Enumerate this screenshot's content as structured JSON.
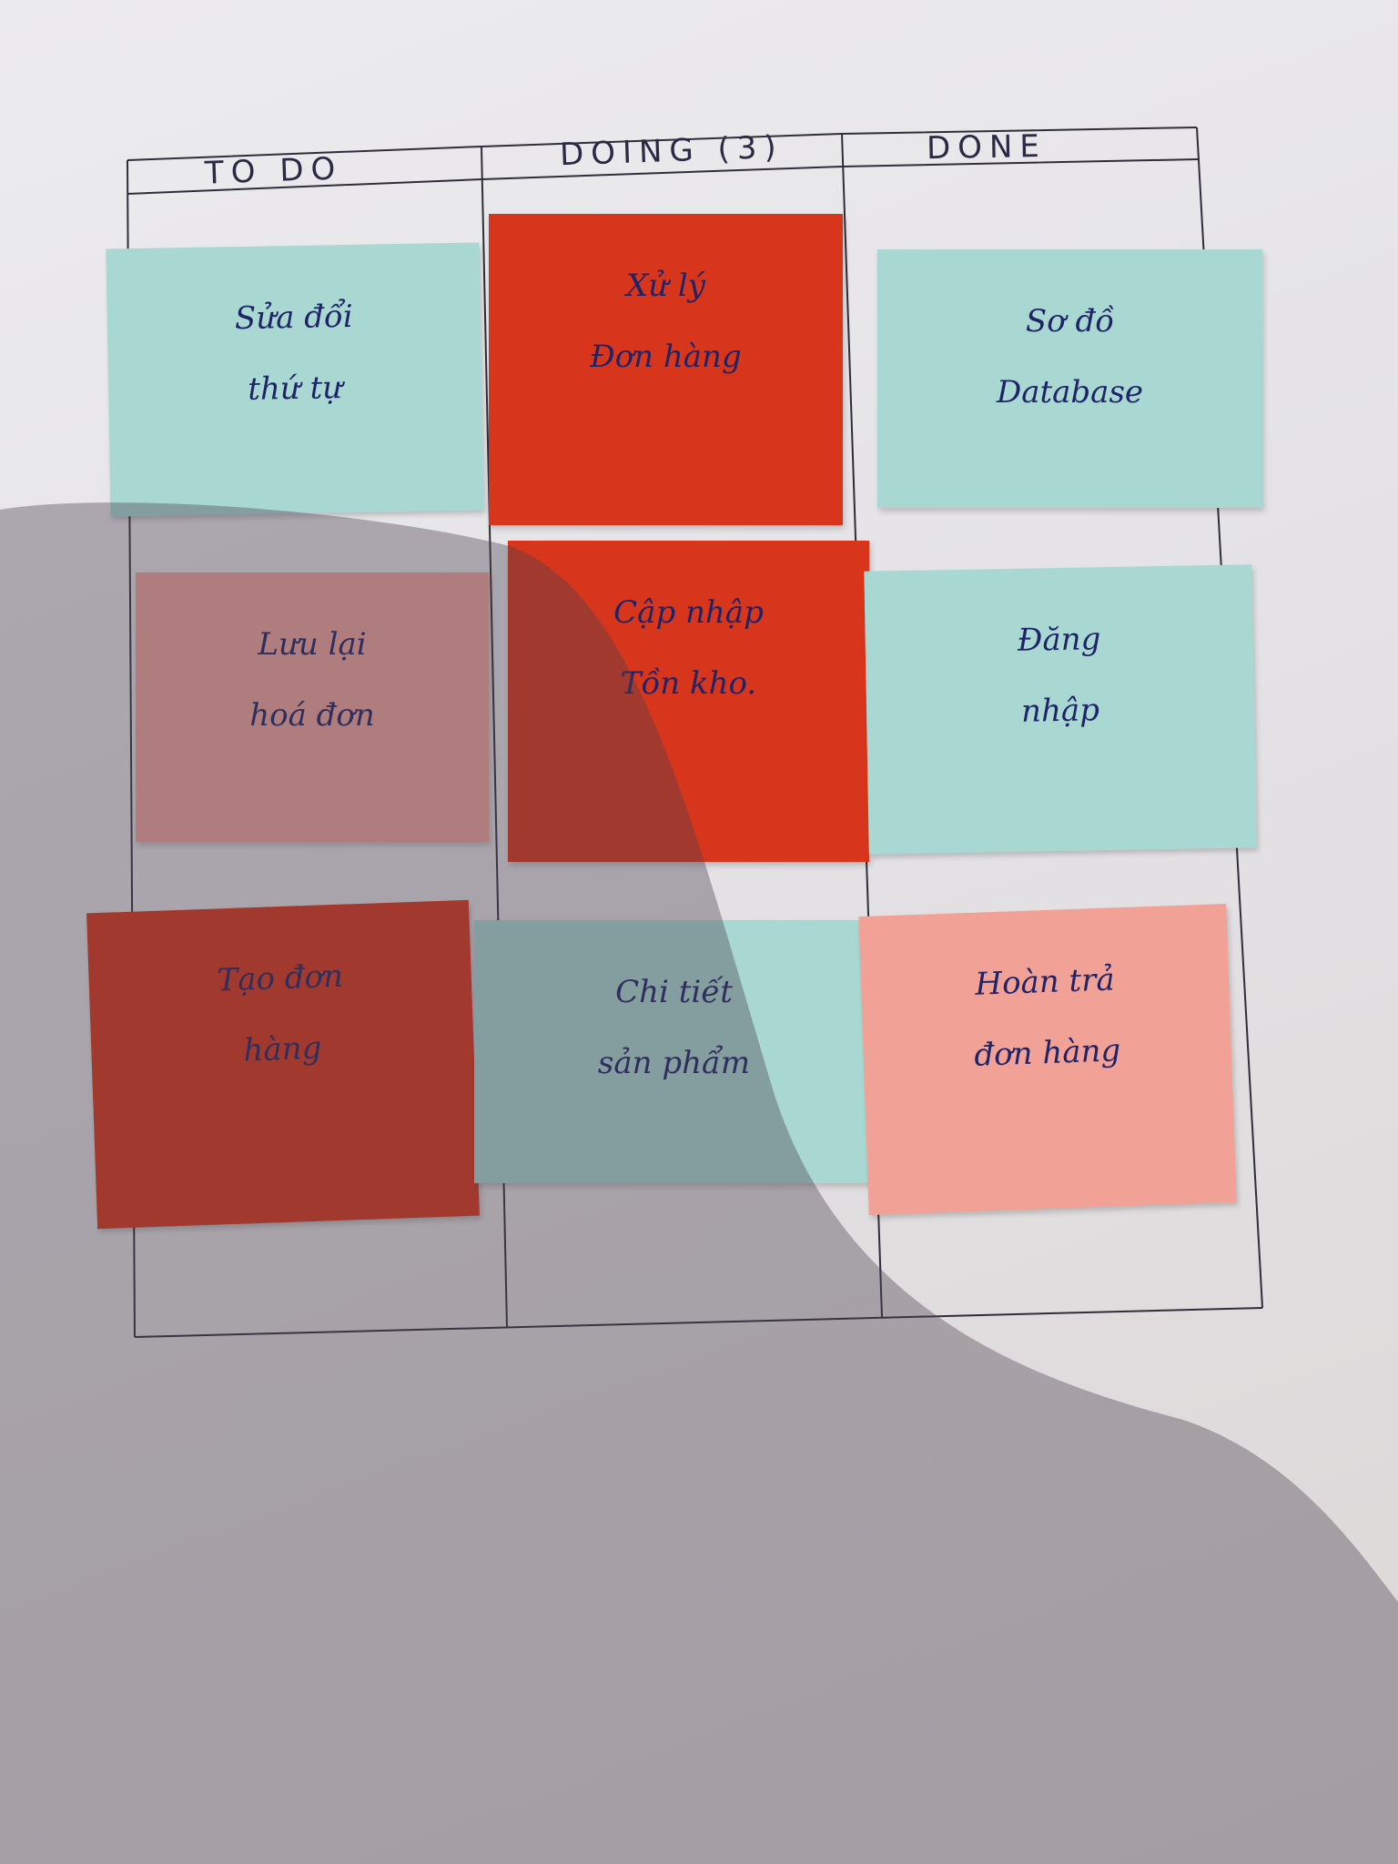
{
  "board": {
    "columns": [
      "TO DO",
      "DOING (3)",
      "DONE"
    ],
    "notes": [
      {
        "column": "TO DO",
        "color": "#a9d8d2",
        "line1": "Sửa đổi",
        "line2": "thứ tự"
      },
      {
        "column": "DOING (3)",
        "color": "#d8361c",
        "line1": "Xử lý",
        "line2": "Đơn hàng"
      },
      {
        "column": "DONE",
        "color": "#a9d8d2",
        "line1": "Sơ đồ",
        "line2": "Database"
      },
      {
        "column": "TO DO",
        "color": "#eea39d",
        "line1": "Lưu lại",
        "line2": "hoá đơn"
      },
      {
        "column": "DOING (3)",
        "color": "#d8361c",
        "line1": "Cập nhập",
        "line2": "Tồn kho."
      },
      {
        "column": "DONE",
        "color": "#a9d8d2",
        "line1": "Đăng",
        "line2": "nhập"
      },
      {
        "column": "TO DO",
        "color": "#d8361c",
        "line1": "Tạo đơn",
        "line2": "hàng"
      },
      {
        "column": "DOING (3)",
        "color": "#a9d8d2",
        "line1": "Chi tiết",
        "line2": "sản phẩm"
      },
      {
        "column": "DONE",
        "color": "#f2a196",
        "line1": "Hoàn trả",
        "line2": "đơn hàng"
      }
    ]
  }
}
